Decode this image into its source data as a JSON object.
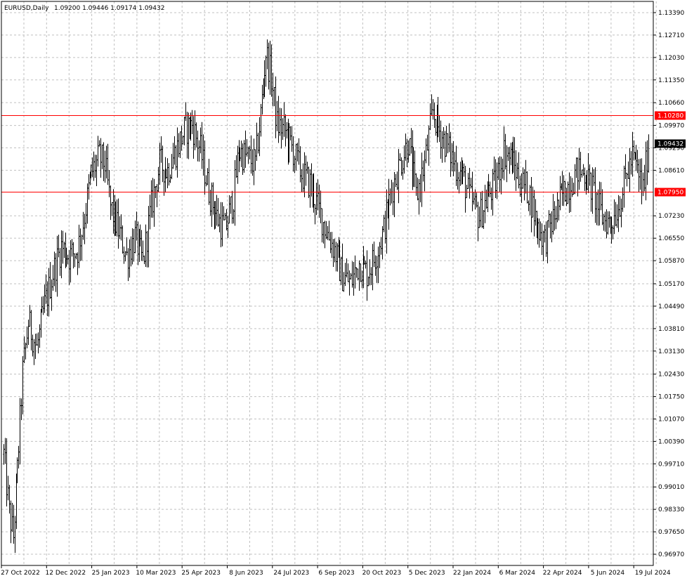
{
  "header": {
    "symbol": "EURUSD,Daily",
    "ohlc": "1.09200 1.09446 1.09174 1.09432"
  },
  "colors": {
    "background": "#ffffff",
    "grid": "#c0c0c0",
    "bars": "#000000",
    "level_line": "#ff0000",
    "price_label_bg": "#000000"
  },
  "chart_data": {
    "type": "ohlc",
    "grid": true,
    "ylim": [
      0.9663,
      1.1373
    ],
    "y_ticks": [
      "1.13390",
      "1.12710",
      "1.12030",
      "1.11350",
      "1.10660",
      "1.09970",
      "1.09290",
      "1.08610",
      "1.07230",
      "1.06550",
      "1.05870",
      "1.05170",
      "1.04490",
      "1.03810",
      "1.03130",
      "1.02430",
      "1.01750",
      "1.01070",
      "1.00390",
      "0.99710",
      "0.99010",
      "0.98330",
      "0.97650",
      "0.96970"
    ],
    "x_ticks": [
      "27 Oct 2022",
      "12 Dec 2022",
      "25 Jan 2023",
      "10 Mar 2023",
      "25 Apr 2023",
      "8 Jun 2023",
      "24 Jul 2023",
      "6 Sep 2023",
      "20 Oct 2023",
      "5 Dec 2023",
      "22 Jan 2024",
      "6 Mar 2024",
      "22 Apr 2024",
      "5 Jun 2024",
      "19 Jul 2024"
    ],
    "horizontal_levels": [
      {
        "value": 1.1028,
        "label": "1.10280"
      },
      {
        "value": 1.0795,
        "label": "1.07950"
      }
    ],
    "current_price": {
      "value": 1.09432,
      "label": "1.09432"
    },
    "close_path": [
      {
        "i": 0,
        "v": 1.0
      },
      {
        "i": 4,
        "v": 0.982
      },
      {
        "i": 7,
        "v": 0.975
      },
      {
        "i": 10,
        "v": 0.995
      },
      {
        "i": 14,
        "v": 1.025
      },
      {
        "i": 18,
        "v": 1.04
      },
      {
        "i": 24,
        "v": 1.032
      },
      {
        "i": 30,
        "v": 1.045
      },
      {
        "i": 36,
        "v": 1.055
      },
      {
        "i": 42,
        "v": 1.063
      },
      {
        "i": 48,
        "v": 1.06
      },
      {
        "i": 54,
        "v": 1.062
      },
      {
        "i": 58,
        "v": 1.07
      },
      {
        "i": 64,
        "v": 1.085
      },
      {
        "i": 70,
        "v": 1.09
      },
      {
        "i": 74,
        "v": 1.088
      },
      {
        "i": 78,
        "v": 1.075
      },
      {
        "i": 84,
        "v": 1.068
      },
      {
        "i": 90,
        "v": 1.06
      },
      {
        "i": 96,
        "v": 1.066
      },
      {
        "i": 102,
        "v": 1.058
      },
      {
        "i": 108,
        "v": 1.075
      },
      {
        "i": 114,
        "v": 1.088
      },
      {
        "i": 120,
        "v": 1.086
      },
      {
        "i": 126,
        "v": 1.092
      },
      {
        "i": 132,
        "v": 1.098
      },
      {
        "i": 138,
        "v": 1.1
      },
      {
        "i": 144,
        "v": 1.092
      },
      {
        "i": 150,
        "v": 1.08
      },
      {
        "i": 156,
        "v": 1.072
      },
      {
        "i": 162,
        "v": 1.068
      },
      {
        "i": 168,
        "v": 1.078
      },
      {
        "i": 172,
        "v": 1.092
      },
      {
        "i": 178,
        "v": 1.09
      },
      {
        "i": 184,
        "v": 1.088
      },
      {
        "i": 188,
        "v": 1.103
      },
      {
        "i": 192,
        "v": 1.122
      },
      {
        "i": 196,
        "v": 1.114
      },
      {
        "i": 200,
        "v": 1.1
      },
      {
        "i": 206,
        "v": 1.098
      },
      {
        "i": 212,
        "v": 1.092
      },
      {
        "i": 218,
        "v": 1.085
      },
      {
        "i": 224,
        "v": 1.082
      },
      {
        "i": 230,
        "v": 1.075
      },
      {
        "i": 236,
        "v": 1.068
      },
      {
        "i": 242,
        "v": 1.062
      },
      {
        "i": 248,
        "v": 1.054
      },
      {
        "i": 254,
        "v": 1.052
      },
      {
        "i": 260,
        "v": 1.058
      },
      {
        "i": 266,
        "v": 1.055
      },
      {
        "i": 272,
        "v": 1.06
      },
      {
        "i": 278,
        "v": 1.068
      },
      {
        "i": 284,
        "v": 1.08
      },
      {
        "i": 290,
        "v": 1.088
      },
      {
        "i": 296,
        "v": 1.095
      },
      {
        "i": 302,
        "v": 1.078
      },
      {
        "i": 308,
        "v": 1.088
      },
      {
        "i": 314,
        "v": 1.104
      },
      {
        "i": 318,
        "v": 1.099
      },
      {
        "i": 324,
        "v": 1.094
      },
      {
        "i": 330,
        "v": 1.088
      },
      {
        "i": 336,
        "v": 1.084
      },
      {
        "i": 342,
        "v": 1.077
      },
      {
        "i": 348,
        "v": 1.072
      },
      {
        "i": 354,
        "v": 1.078
      },
      {
        "i": 360,
        "v": 1.082
      },
      {
        "i": 366,
        "v": 1.092
      },
      {
        "i": 372,
        "v": 1.089
      },
      {
        "i": 378,
        "v": 1.083
      },
      {
        "i": 384,
        "v": 1.08
      },
      {
        "i": 390,
        "v": 1.07
      },
      {
        "i": 396,
        "v": 1.065
      },
      {
        "i": 402,
        "v": 1.071
      },
      {
        "i": 408,
        "v": 1.078
      },
      {
        "i": 414,
        "v": 1.082
      },
      {
        "i": 420,
        "v": 1.086
      },
      {
        "i": 426,
        "v": 1.085
      },
      {
        "i": 432,
        "v": 1.079
      },
      {
        "i": 438,
        "v": 1.072
      },
      {
        "i": 444,
        "v": 1.07
      },
      {
        "i": 450,
        "v": 1.075
      },
      {
        "i": 456,
        "v": 1.085
      },
      {
        "i": 460,
        "v": 1.09
      },
      {
        "i": 464,
        "v": 1.086
      },
      {
        "i": 468,
        "v": 1.08
      },
      {
        "i": 472,
        "v": 1.094
      }
    ],
    "bar_count": 473
  }
}
